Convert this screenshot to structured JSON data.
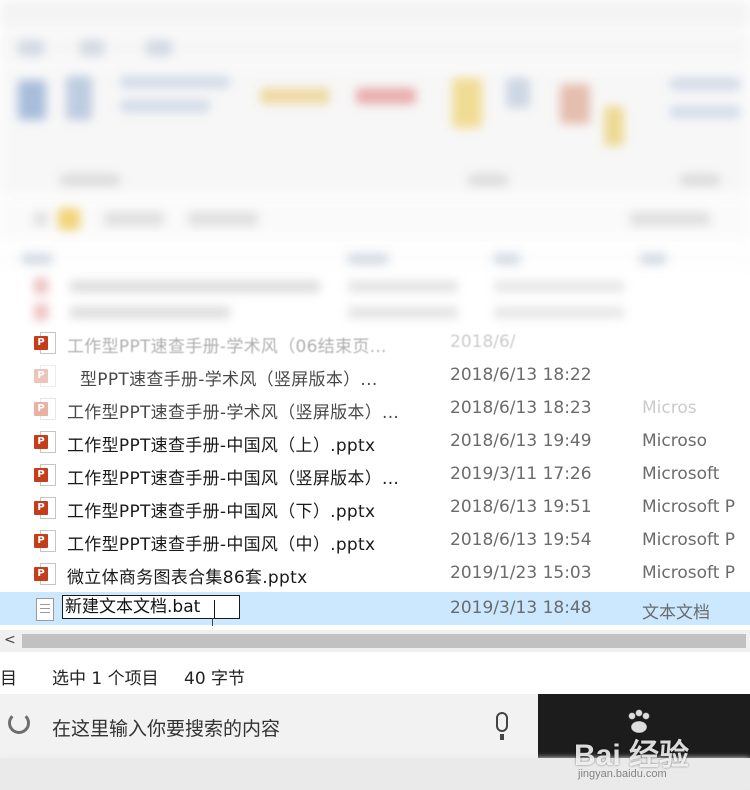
{
  "files": [
    {
      "name": "工作型PPT速查手册-学术风（06结束页...",
      "date": "2018/6/",
      "type": "",
      "icon": "ppt-icon",
      "state": "faint"
    },
    {
      "name": "型PPT速查手册-学术风（竖屏版本）...",
      "date": "2018/6/13 18:22",
      "type": "",
      "icon": "ppt-icon",
      "state": "mid"
    },
    {
      "name": "工作型PPT速查手册-学术风（竖屏版本）...",
      "date": "2018/6/13 18:23",
      "type": "Micros",
      "icon": "ppt-icon",
      "state": "mid"
    },
    {
      "name": "工作型PPT速查手册-中国风（上）.pptx",
      "date": "2018/6/13 19:49",
      "type": "Microso",
      "icon": "ppt-icon",
      "state": "normal"
    },
    {
      "name": "工作型PPT速查手册-中国风（竖屏版本）...",
      "date": "2019/3/11 17:26",
      "type": "Microsoft",
      "icon": "ppt-icon",
      "state": "normal"
    },
    {
      "name": "工作型PPT速查手册-中国风（下）.pptx",
      "date": "2018/6/13 19:51",
      "type": "Microsoft P",
      "icon": "ppt-icon",
      "state": "normal"
    },
    {
      "name": "工作型PPT速查手册-中国风（中）.pptx",
      "date": "2018/6/13 19:54",
      "type": "Microsoft P",
      "icon": "ppt-icon",
      "state": "normal"
    },
    {
      "name": "微立体商务图表合集86套.pptx",
      "date": "2019/1/23 15:03",
      "type": "Microsoft P",
      "icon": "ppt-icon",
      "state": "normal"
    }
  ],
  "rename_row": {
    "value": "新建文本文档.bat",
    "date": "2019/3/13 18:48",
    "type": "文本文档",
    "icon": "text-file-icon"
  },
  "scrollbar": {
    "left_arrow": "<"
  },
  "status": {
    "items_label": "目",
    "selected": "选中 1 个项目",
    "size": "40 字节"
  },
  "taskbar": {
    "search_placeholder": "在这里输入你要搜索的内容"
  },
  "watermark": {
    "logo": "Bai 经验",
    "url": "jingyan.baidu.com"
  },
  "colors": {
    "selection": "#cce8ff",
    "ppt_badge": "#c43e1c"
  }
}
